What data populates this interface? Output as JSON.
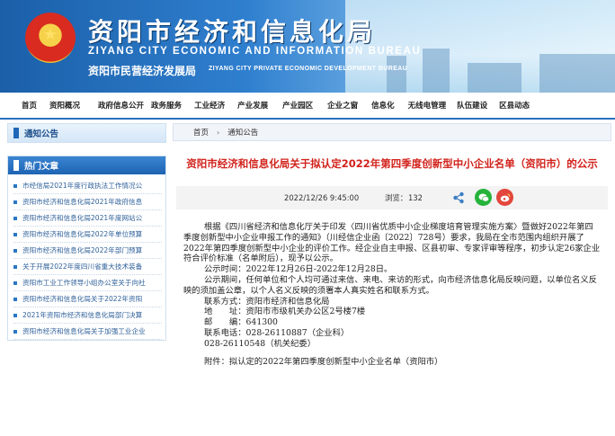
{
  "banner": {
    "title_cn": "资阳市经济和信息化局",
    "title_en": "ZIYANG CITY ECONOMIC AND INFORMATION BUREAU",
    "sub_cn": "资阳市民营经济发展局",
    "sub_en": "ZIYANG CITY PRIVATE ECONOMIC DEVELOPMENT BUREAU"
  },
  "nav": {
    "items": [
      "首页",
      "资阳概况",
      "政府信息公开",
      "政务服务",
      "工业经济",
      "产业发展",
      "产业园区",
      "企业之窗",
      "信息化",
      "无线电管理",
      "队伍建设",
      "区县动态"
    ]
  },
  "sidebar": {
    "notice_title": "通知公告",
    "hot_title": "热门文章",
    "hot_items": [
      "市经信局2021年度行政执法工作情况公",
      "资阳市经济和信息化局2021年政府信息",
      "资阳市经济和信息化局2021年度网站公",
      "资阳市经济和信息化局2022年单位预算",
      "资阳市经济和信息化局2022年部门预算",
      "关于开展2022年度四川省重大技术装备",
      "资阳市工业工作领导小组办公室关于向社",
      "资阳市经济和信息化局关于2022年资阳",
      "2021年资阳市经济和信息化局部门决算",
      "资阳市经济和信息化局关于加强工业企业"
    ]
  },
  "main": {
    "breadcrumb": {
      "home": "首页",
      "arrow": "›",
      "current": "通知公告"
    },
    "title": "资阳市经济和信息化局关于拟认定2022年第四季度创新型中小企业名单（资阳市）的公示",
    "date": "2022/12/26 9:45:00",
    "views_label": "浏览：",
    "views": "132",
    "body": {
      "p1": "根据《四川省经济和信息化厅关于印发〈四川省优质中小企业梯度培育管理实施方案〉暨做好2022年第四季度创新型中小企业申报工作的通知》（川经信企业函〔2022〕728号）要求，我局在全市范围内组织开展了2022年第四季度创新型中小企业的评价工作。经企业自主申报、区县初审、专家评审等程序，初步认定26家企业符合评价标准（名单附后），现予以公示。",
      "p2": "公示时间：2022年12月26日-2022年12月28日。",
      "p3": "公示期间，任何单位和个人均可通过来信、来电、来访的形式，向市经济信息化局反映问题，以单位名义反映的须加盖公章，以个人名义反映的须署本人真实姓名和联系方式。",
      "c1": "联系方式：资阳市经济和信息化局",
      "c2": "地　　址：资阳市市级机关办公区2号楼7楼",
      "c3": "邮　　编：641300",
      "c4": "联系电话：028-26110887（企业科）",
      "c5": "028-26110548（机关纪委）",
      "att": "附件：拟认定的2022年第四季度创新型中小企业名单（资阳市）"
    }
  },
  "colors": {
    "brand": "#1e63b3",
    "title_red": "#d2231c"
  }
}
